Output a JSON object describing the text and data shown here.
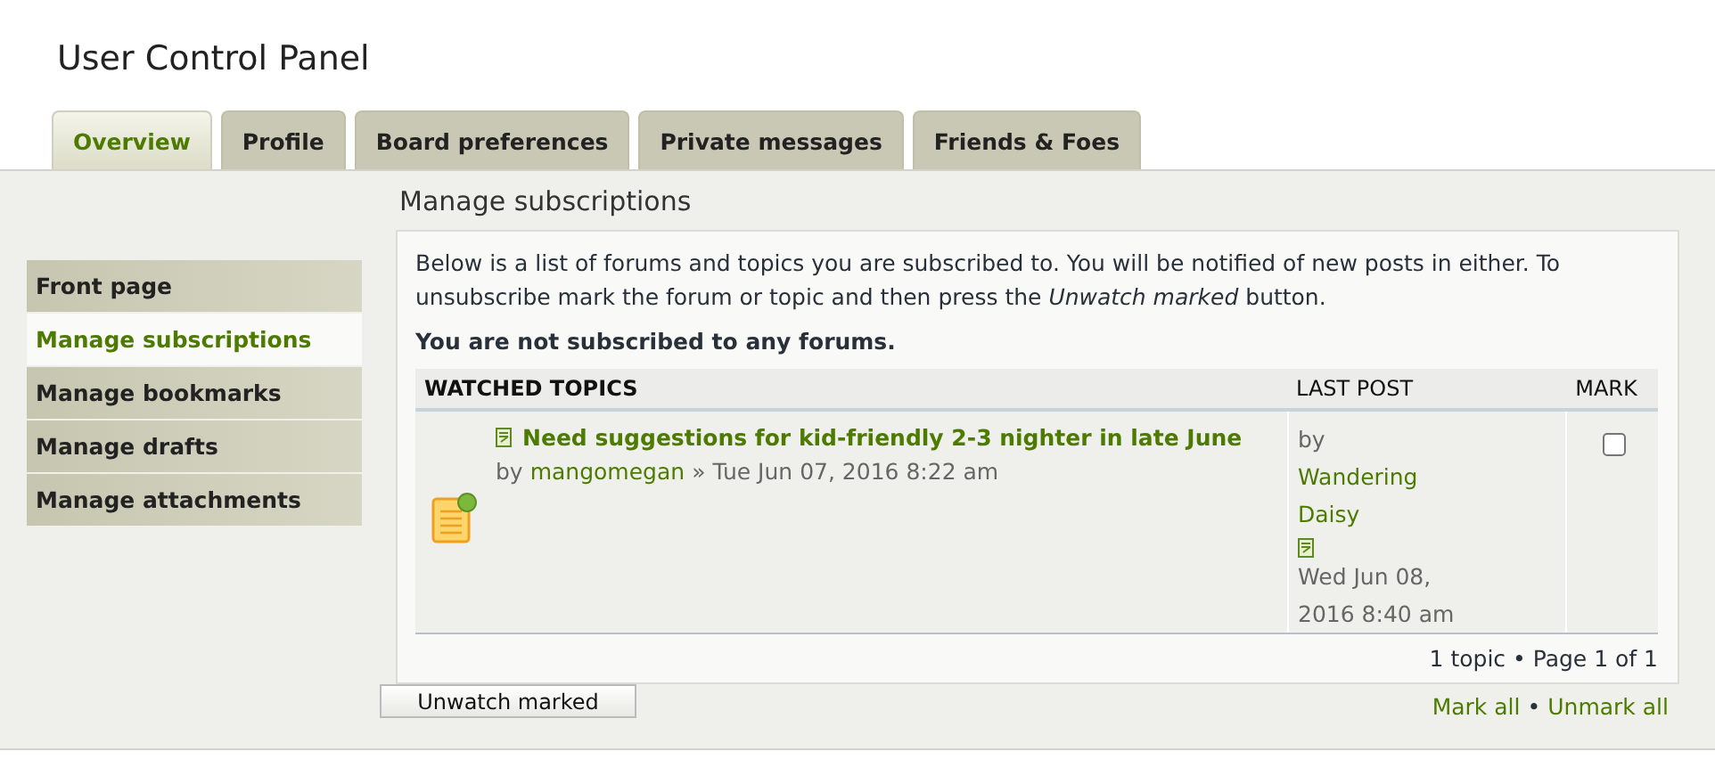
{
  "page_title": "User Control Panel",
  "tabs": [
    {
      "label": "Overview",
      "selected": true
    },
    {
      "label": "Profile",
      "selected": false
    },
    {
      "label": "Board preferences",
      "selected": false
    },
    {
      "label": "Private messages",
      "selected": false
    },
    {
      "label": "Friends & Foes",
      "selected": false
    }
  ],
  "sidebar": {
    "items": [
      {
        "label": "Front page",
        "selected": false
      },
      {
        "label": "Manage subscriptions",
        "selected": true
      },
      {
        "label": "Manage bookmarks",
        "selected": false
      },
      {
        "label": "Manage drafts",
        "selected": false
      },
      {
        "label": "Manage attachments",
        "selected": false
      }
    ]
  },
  "heading": "Manage subscriptions",
  "description": "Below is a list of forums and topics you are subscribed to. You will be notified of new posts in either. To unsubscribe mark the forum or topic and then press the *Unwatch marked* button.",
  "notice": "You are not subscribed to any forums.",
  "table": {
    "columns": [
      "WATCHED TOPICS",
      "LAST POST",
      "MARK"
    ],
    "rows": [
      {
        "title": "Need suggestions for kid-friendly 2-3 nighter in late June",
        "by": "by",
        "author": "mangomegan",
        "separator": "»",
        "date": "Tue Jun 07, 2016 8:22 am",
        "last_by": "by",
        "last_author": "Wandering Daisy",
        "last_date": "Wed Jun 08, 2016 8:40 am",
        "checked": false
      }
    ]
  },
  "pagination": "1 topic • Page 1 of 1",
  "unwatch_button": "Unwatch marked",
  "links": {
    "mark_all": "Mark all",
    "separator": "•",
    "unmark_all": "Unmark all"
  }
}
